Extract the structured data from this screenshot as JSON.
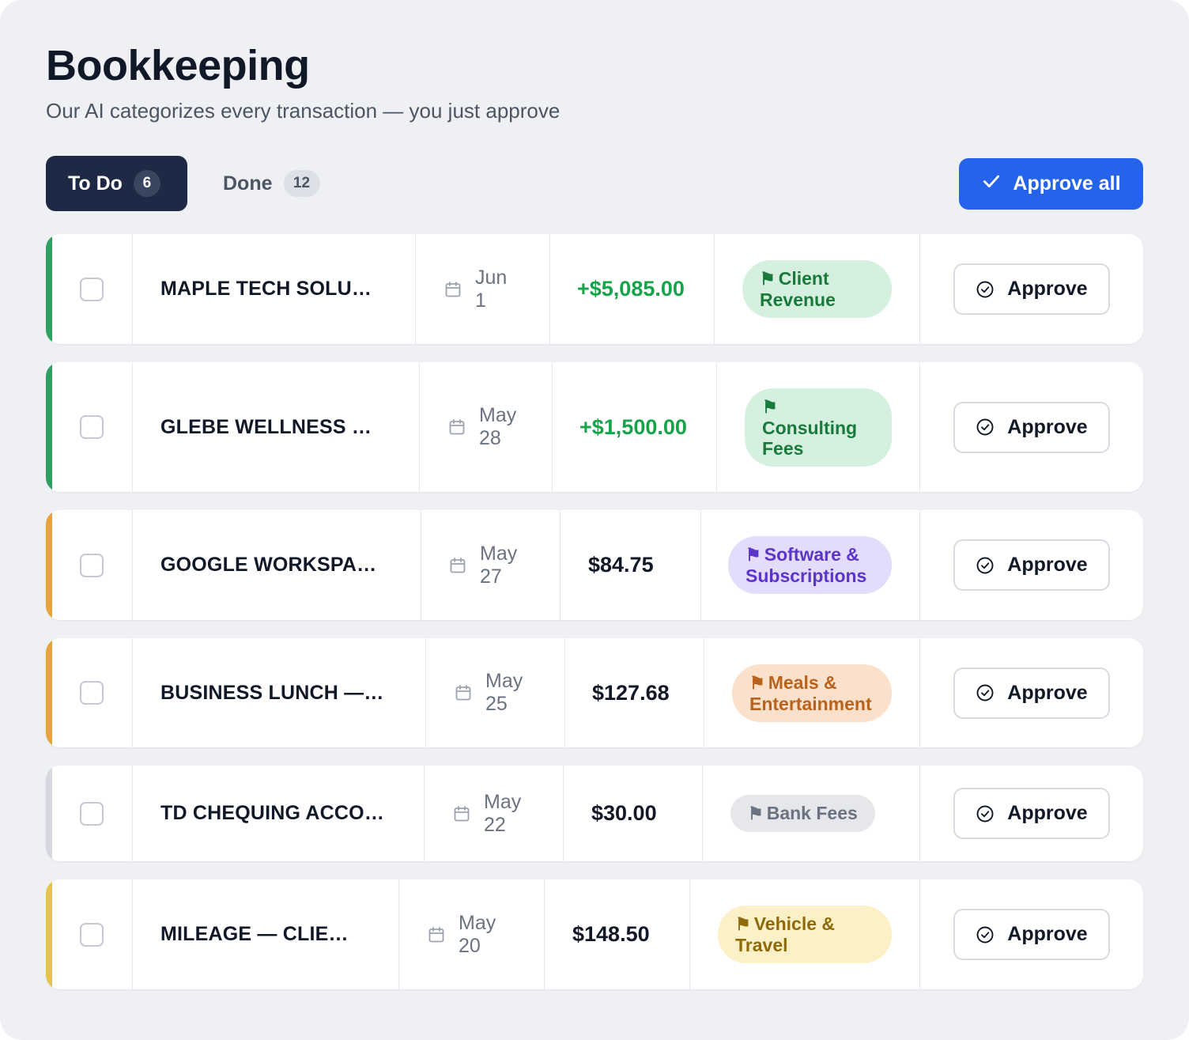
{
  "header": {
    "title": "Bookkeeping",
    "subtitle": "Our AI categorizes every transaction — you just approve"
  },
  "tabs": [
    {
      "label": "To Do",
      "count": "6",
      "active": true
    },
    {
      "label": "Done",
      "count": "12",
      "active": false
    }
  ],
  "toolbar": {
    "approve_all_label": "Approve all",
    "approve_all_icon": "check-icon"
  },
  "colors": {
    "accent_blue": "#2563eb",
    "tab_active_bg": "#1e2a45",
    "positive_amount": "#16a34a"
  },
  "transactions": [
    {
      "vendor": "MAPLE TECH SOLU…",
      "month": "Jun",
      "day": "1",
      "amount": "+$5,085.00",
      "positive": true,
      "category": "Client Revenue",
      "category_style": "green",
      "accent": "#2ea05f",
      "approve_label": "Approve"
    },
    {
      "vendor": "GLEBE WELLNESS …",
      "month": "May",
      "day": "28",
      "amount": "+$1,500.00",
      "positive": true,
      "category": "Consulting Fees",
      "category_style": "green",
      "accent": "#2ea05f",
      "approve_label": "Approve"
    },
    {
      "vendor": "GOOGLE WORKSPA…",
      "month": "May",
      "day": "27",
      "amount": "$84.75",
      "positive": false,
      "category": "Software & Subscriptions",
      "category_style": "purple",
      "accent": "#e8a33d",
      "approve_label": "Approve"
    },
    {
      "vendor": "BUSINESS LUNCH —…",
      "month": "May",
      "day": "25",
      "amount": "$127.68",
      "positive": false,
      "category": "Meals & Entertainment",
      "category_style": "orange",
      "accent": "#e8a33d",
      "approve_label": "Approve"
    },
    {
      "vendor": "TD CHEQUING ACCO…",
      "month": "May",
      "day": "22",
      "amount": "$30.00",
      "positive": false,
      "category": "Bank Fees",
      "category_style": "gray",
      "accent": "#d4d8de",
      "approve_label": "Approve"
    },
    {
      "vendor": "MILEAGE — CLIE…",
      "month": "May",
      "day": "20",
      "amount": "$148.50",
      "positive": false,
      "category": "Vehicle & Travel",
      "category_style": "yellow",
      "accent": "#e6c44a",
      "approve_label": "Approve"
    }
  ]
}
